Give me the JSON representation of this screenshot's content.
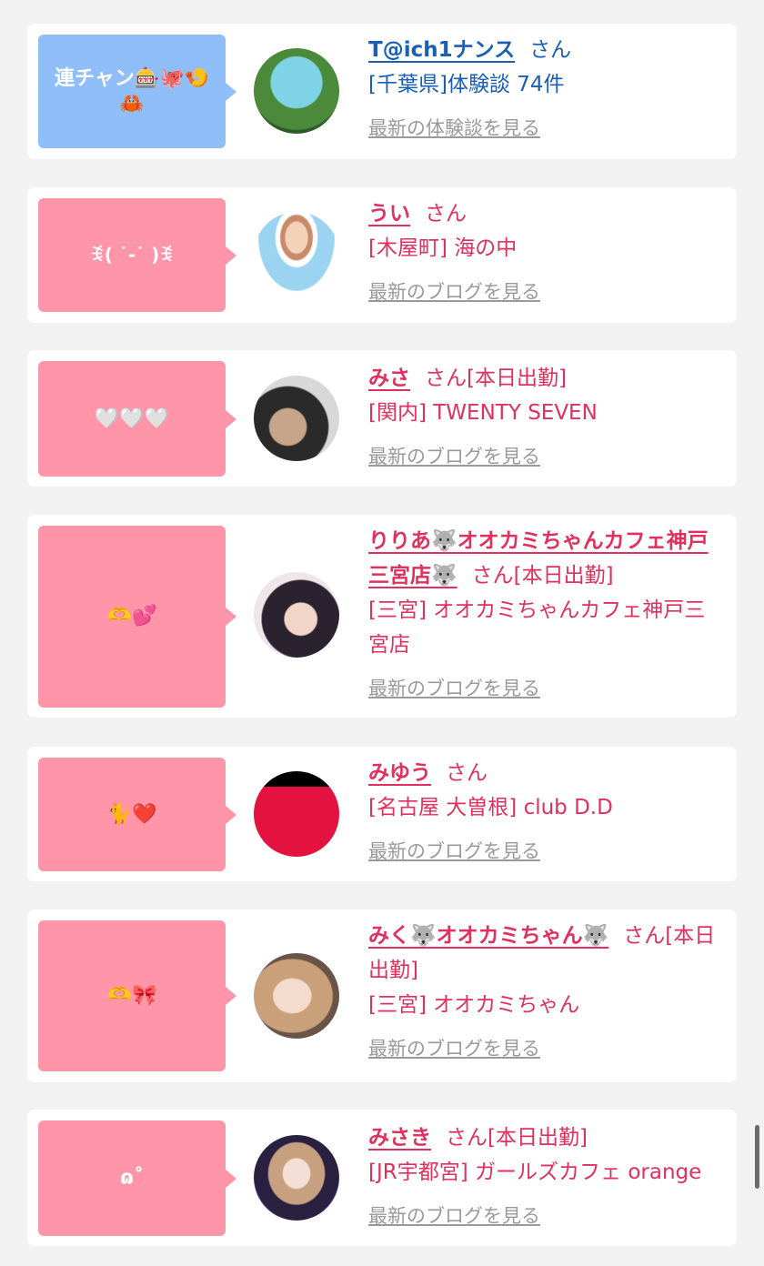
{
  "entries": [
    {
      "bubble": "連チャン🎰🐙🍤🦀",
      "name": "T@ich1ナンス",
      "honorific": "さん",
      "status": "",
      "line2": "[千葉県]体験談 74件",
      "line3": "",
      "link": "最新の体験談を見る",
      "theme": "blue"
    },
    {
      "bubble": "ꉂ( ˙-˙ )ꉂ",
      "name": "うい",
      "honorific": "さん",
      "status": "",
      "line2": "[木屋町] 海の中",
      "line3": "",
      "link": "最新のブログを見る",
      "theme": "pink"
    },
    {
      "bubble": "🤍🤍🤍",
      "name": "みさ",
      "honorific": "さん",
      "status": "[本日出勤]",
      "line2": "[関内] TWENTY SEVEN",
      "line3": "",
      "link": "最新のブログを見る",
      "theme": "pink"
    },
    {
      "bubble": "🫶💕",
      "name": "りりあ🐺オオカミちゃんカフェ神戸三宮店🐺",
      "honorific": "さん",
      "status": "[本日出勤]",
      "line2": "[三宮] オオカミちゃんカフェ神戸三宮店",
      "line3": "",
      "link": "最新のブログを見る",
      "theme": "pink"
    },
    {
      "bubble": "🐈❤️",
      "name": "みゆう",
      "honorific": "さん",
      "status": "",
      "line2": "[名古屋 大曽根] club D.D",
      "line3": "",
      "link": "最新のブログを見る",
      "theme": "pink"
    },
    {
      "bubble": "🫶🎀",
      "name": "みく🐺オオカミちゃん🐺",
      "honorific": "さん",
      "status": "[本日出勤]",
      "line2": "[三宮] オオカミちゃん",
      "line3": "",
      "link": "最新のブログを見る",
      "theme": "pink"
    },
    {
      "bubble": "ɷ˚",
      "name": "みさき",
      "honorific": "さん",
      "status": "[本日出勤]",
      "line2": "[JR宇都宮] ガールズカフェ orange",
      "line3": "",
      "link": "最新のブログを見る",
      "theme": "pink"
    }
  ],
  "colors": {
    "pink_bubble": "#ff95a8",
    "blue_bubble": "#8fbef8",
    "pink_text": "#e0305d",
    "blue_text": "#1a5fb4"
  }
}
